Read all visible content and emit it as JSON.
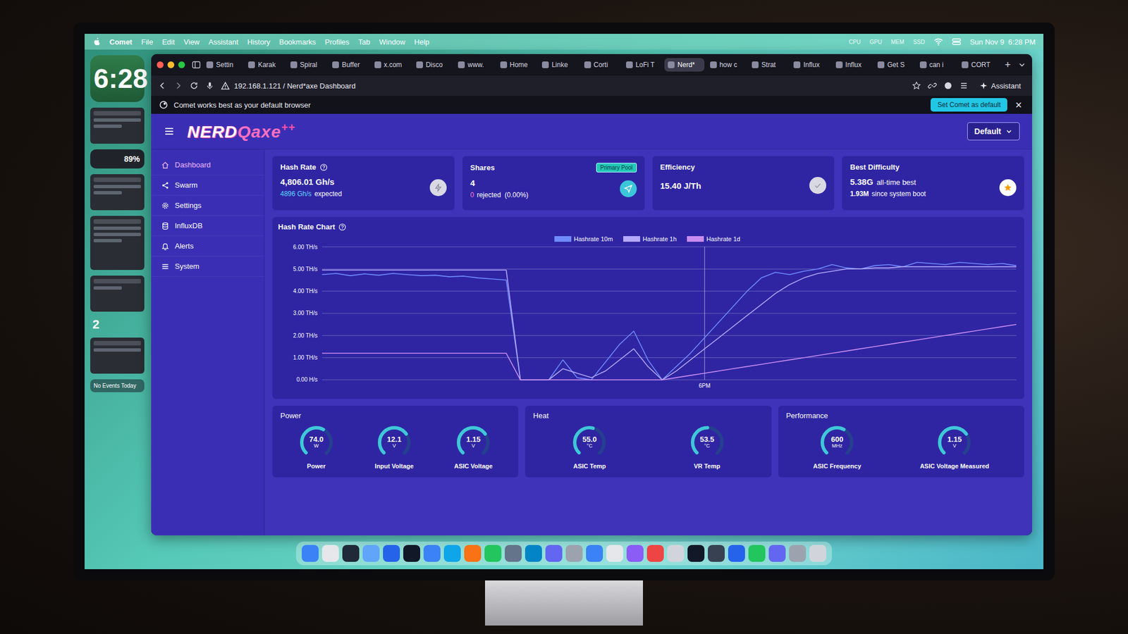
{
  "menu_bar": {
    "app": "Comet",
    "items": [
      "File",
      "Edit",
      "View",
      "Assistant",
      "History",
      "Bookmarks",
      "Profiles",
      "Tab",
      "Window",
      "Help"
    ],
    "status": [
      "CPU",
      "GPU",
      "MEM",
      "SSD"
    ],
    "clock": "Sun Nov 9  6:28 PM"
  },
  "desktop": {
    "clock_widget": "6:28",
    "battery": "89%",
    "desktop_number": "2",
    "calendar": "No Events Today"
  },
  "browser": {
    "tabs": [
      {
        "label": "Settin",
        "selected": false
      },
      {
        "label": "Karak",
        "selected": false
      },
      {
        "label": "Spiral",
        "selected": false
      },
      {
        "label": "Buffer",
        "selected": false
      },
      {
        "label": "x.com",
        "selected": false
      },
      {
        "label": "Disco",
        "selected": false
      },
      {
        "label": "www.",
        "selected": false
      },
      {
        "label": "Home",
        "selected": false
      },
      {
        "label": "Linke",
        "selected": false
      },
      {
        "label": "Corti",
        "selected": false
      },
      {
        "label": "LoFi T",
        "selected": false
      },
      {
        "label": "Nerd*",
        "selected": true
      },
      {
        "label": "how c",
        "selected": false
      },
      {
        "label": "Strat",
        "selected": false
      },
      {
        "label": "Influx",
        "selected": false
      },
      {
        "label": "Influx",
        "selected": false
      },
      {
        "label": "Get S",
        "selected": false
      },
      {
        "label": "can i",
        "selected": false
      },
      {
        "label": "CORT",
        "selected": false
      }
    ],
    "new_tab": "+",
    "address": "192.168.1.121 / Nerd*axe Dashboard",
    "assistant": "Assistant",
    "banner": {
      "text": "Comet works best as your default browser",
      "button": "Set Comet as default",
      "close": "×"
    }
  },
  "dashboard": {
    "logo": {
      "part1": "NERD",
      "part2": "Qaxe",
      "suffix": "++"
    },
    "profile_dropdown": "Default",
    "sidebar": [
      {
        "label": "Dashboard",
        "selected": true,
        "kind": "home"
      },
      {
        "label": "Swarm",
        "selected": false,
        "kind": "share"
      },
      {
        "label": "Settings",
        "selected": false,
        "kind": "gear"
      },
      {
        "label": "InfluxDB",
        "selected": false,
        "kind": "database"
      },
      {
        "label": "Alerts",
        "selected": false,
        "kind": "bell"
      },
      {
        "label": "System",
        "selected": false,
        "kind": "list"
      }
    ],
    "cards": [
      {
        "title": "Hash Rate",
        "help": true,
        "badge": "",
        "value": "4,806.01 Gh/s",
        "value_suffix": "",
        "sub_value": "4896 Gh/s",
        "sub_label": "expected",
        "kind": "bolt"
      },
      {
        "title": "Shares",
        "help": false,
        "badge": "Primary Pool",
        "value": "4",
        "value_suffix": "",
        "sub_value": "0",
        "sub_label": "rejected  (0.00%)",
        "kind": "send"
      },
      {
        "title": "Efficiency",
        "help": false,
        "badge": "",
        "value": "15.40 J/Th",
        "value_suffix": "",
        "sub_value": "",
        "sub_label": "",
        "kind": "check"
      },
      {
        "title": "Best Difficulty",
        "help": false,
        "badge": "",
        "value": "5.38G",
        "value_suffix": "all-time best",
        "sub_value": "1.93M",
        "sub_label": "since system boot",
        "kind": "star"
      }
    ],
    "chart": {
      "title": "Hash Rate Chart",
      "y_ticks": [
        {
          "label": "6.00 TH/s",
          "value": 6
        },
        {
          "label": "5.00 TH/s",
          "value": 5
        },
        {
          "label": "4.00 TH/s",
          "value": 4
        },
        {
          "label": "3.00 TH/s",
          "value": 3
        },
        {
          "label": "2.00 TH/s",
          "value": 2
        },
        {
          "label": "1.00 TH/s",
          "value": 1
        },
        {
          "label": "0.00 H/s",
          "value": 0
        }
      ],
      "x_ticks": [
        {
          "label": "6PM",
          "index": 27
        }
      ],
      "series": [
        {
          "label": "Hashrate 10m",
          "color": "#6f8cff",
          "values": [
            4.75,
            4.8,
            4.7,
            4.78,
            4.72,
            4.8,
            4.75,
            4.7,
            4.72,
            4.65,
            4.68,
            4.6,
            4.55,
            4.5,
            0,
            0,
            0,
            0.9,
            0.1,
            0,
            0.8,
            1.6,
            2.2,
            0.9,
            0,
            0.6,
            1.2,
            1.9,
            2.6,
            3.3,
            4.0,
            4.6,
            4.85,
            4.75,
            4.9,
            5.0,
            5.2,
            5.05,
            5.0,
            5.15,
            5.2,
            5.1,
            5.3,
            5.25,
            5.2,
            5.3,
            5.25,
            5.2,
            5.25,
            5.15
          ]
        },
        {
          "label": "Hashrate 1h",
          "color": "#b4a9ff",
          "values": [
            4.95,
            4.95,
            4.95,
            4.95,
            4.95,
            4.95,
            4.95,
            4.95,
            4.95,
            4.95,
            4.95,
            4.95,
            4.95,
            4.95,
            0,
            0,
            0,
            0.5,
            0.3,
            0.1,
            0.4,
            0.9,
            1.4,
            0.6,
            0,
            0.4,
            0.9,
            1.4,
            1.9,
            2.4,
            2.9,
            3.4,
            3.9,
            4.3,
            4.6,
            4.8,
            4.9,
            5.0,
            5.0,
            5.05,
            5.05,
            5.1,
            5.1,
            5.1,
            5.1,
            5.1,
            5.1,
            5.1,
            5.1,
            5.1
          ]
        },
        {
          "label": "Hashrate 1d",
          "color": "#c98cf0",
          "values": [
            1.2,
            1.2,
            1.2,
            1.2,
            1.2,
            1.2,
            1.2,
            1.2,
            1.2,
            1.2,
            1.2,
            1.2,
            1.2,
            1.2,
            0,
            0,
            0,
            0,
            0,
            0,
            0,
            0,
            0,
            0,
            0,
            0.1,
            0.2,
            0.3,
            0.4,
            0.5,
            0.6,
            0.7,
            0.8,
            0.9,
            1.0,
            1.1,
            1.2,
            1.3,
            1.4,
            1.5,
            1.6,
            1.7,
            1.8,
            1.9,
            2.0,
            2.1,
            2.2,
            2.3,
            2.4,
            2.5
          ]
        }
      ]
    },
    "panels": [
      {
        "title": "Power",
        "gauges": [
          {
            "value": "74.0",
            "unit": "W",
            "label": "Power",
            "level": 0.6
          },
          {
            "value": "12.1",
            "unit": "V",
            "label": "Input Voltage",
            "level": 0.7
          },
          {
            "value": "1.15",
            "unit": "V",
            "label": "ASIC Voltage",
            "level": 0.7
          }
        ]
      },
      {
        "title": "Heat",
        "gauges": [
          {
            "value": "55.0",
            "unit": "°C",
            "label": "ASIC Temp",
            "level": 0.55
          },
          {
            "value": "53.5",
            "unit": "°C",
            "label": "VR Temp",
            "level": 0.5
          }
        ]
      },
      {
        "title": "Performance",
        "gauges": [
          {
            "value": "600",
            "unit": "MHz",
            "label": "ASIC Frequency",
            "level": 0.6
          },
          {
            "value": "1.15",
            "unit": "V",
            "label": "ASIC Voltage Measured",
            "level": 0.7
          }
        ]
      }
    ]
  },
  "dock": {
    "apps": [
      {
        "color": "#3b82f6"
      },
      {
        "color": "#e5e7eb"
      },
      {
        "color": "#1f2937"
      },
      {
        "color": "#60a5fa"
      },
      {
        "color": "#2563eb"
      },
      {
        "color": "#111827"
      },
      {
        "color": "#3b82f6"
      },
      {
        "color": "#0ea5e9"
      },
      {
        "color": "#f97316"
      },
      {
        "color": "#22c55e"
      },
      {
        "color": "#64748b"
      },
      {
        "color": "#0284c7"
      },
      {
        "color": "#6366f1"
      },
      {
        "color": "#9ca3af"
      },
      {
        "color": "#3b82f6"
      },
      {
        "color": "#e5e7eb"
      },
      {
        "color": "#8b5cf6"
      },
      {
        "color": "#ef4444"
      },
      {
        "color": "#d1d5db"
      },
      {
        "color": "#111827"
      },
      {
        "color": "#374151"
      },
      {
        "color": "#2563eb"
      },
      {
        "color": "#22c55e"
      },
      {
        "color": "#6366f1"
      },
      {
        "color": "#9ca3af"
      },
      {
        "color": "#d1d5db"
      }
    ]
  }
}
